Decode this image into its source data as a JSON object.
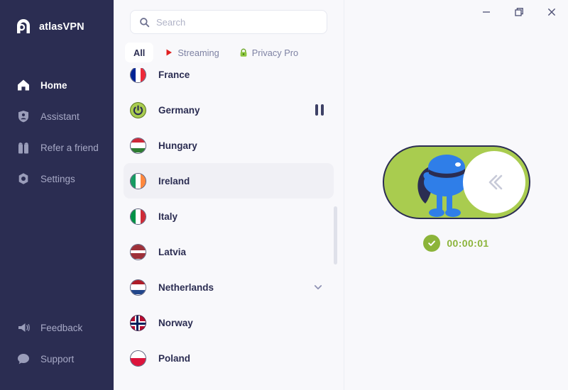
{
  "brand": {
    "name": "atlasVPN",
    "logo_icon": "atlas-logo-icon"
  },
  "sidebar": {
    "top_items": [
      {
        "label": "Home",
        "icon": "home-icon",
        "active": true
      },
      {
        "label": "Assistant",
        "icon": "shield-person-icon",
        "active": false
      },
      {
        "label": "Refer a friend",
        "icon": "gift-icon",
        "active": false
      },
      {
        "label": "Settings",
        "icon": "gear-icon",
        "active": false
      }
    ],
    "bottom_items": [
      {
        "label": "Feedback",
        "icon": "megaphone-icon",
        "active": false
      },
      {
        "label": "Support",
        "icon": "chat-bubble-icon",
        "active": false
      }
    ]
  },
  "search": {
    "value": "",
    "placeholder": "Search",
    "icon": "search-icon"
  },
  "tabs": [
    {
      "label": "All",
      "icon": null,
      "active": true
    },
    {
      "label": "Streaming",
      "icon": "play-triangle-icon",
      "active": false
    },
    {
      "label": "Privacy Pro",
      "icon": "lock-icon",
      "active": false
    }
  ],
  "countries": [
    {
      "name": "France",
      "flag": "fr",
      "partial": true,
      "selected": false,
      "right_icon": null
    },
    {
      "name": "Germany",
      "flag": "power-connected",
      "partial": false,
      "selected": false,
      "right_icon": "pause-icon"
    },
    {
      "name": "Hungary",
      "flag": "hu",
      "partial": false,
      "selected": false,
      "right_icon": null
    },
    {
      "name": "Ireland",
      "flag": "ie",
      "partial": false,
      "selected": true,
      "right_icon": null
    },
    {
      "name": "Italy",
      "flag": "it",
      "partial": false,
      "selected": false,
      "right_icon": null
    },
    {
      "name": "Latvia",
      "flag": "lv",
      "partial": false,
      "selected": false,
      "right_icon": null
    },
    {
      "name": "Netherlands",
      "flag": "nl",
      "partial": false,
      "selected": false,
      "right_icon": "chevron-down-icon"
    },
    {
      "name": "Norway",
      "flag": "no",
      "partial": false,
      "selected": false,
      "right_icon": null
    },
    {
      "name": "Poland",
      "flag": "pl",
      "partial": false,
      "selected": false,
      "right_icon": null
    }
  ],
  "window_controls": [
    {
      "name": "minimize",
      "glyph": "minimize-icon"
    },
    {
      "name": "maximize",
      "glyph": "restore-icon"
    },
    {
      "name": "close",
      "glyph": "close-icon"
    }
  ],
  "connection": {
    "state": "connected",
    "toggle_icon": "double-chevron-left-icon",
    "status_icon": "check-circle-icon",
    "timer": "00:00:01"
  },
  "colors": {
    "sidebar_bg": "#2b2d52",
    "panel_bg": "#f8f8fb",
    "accent_green": "#a9cc4f",
    "status_green": "#8cb43a",
    "text_dark": "#2b2d52",
    "text_muted": "#7e82a3",
    "selected_row": "#f0f0f5"
  }
}
